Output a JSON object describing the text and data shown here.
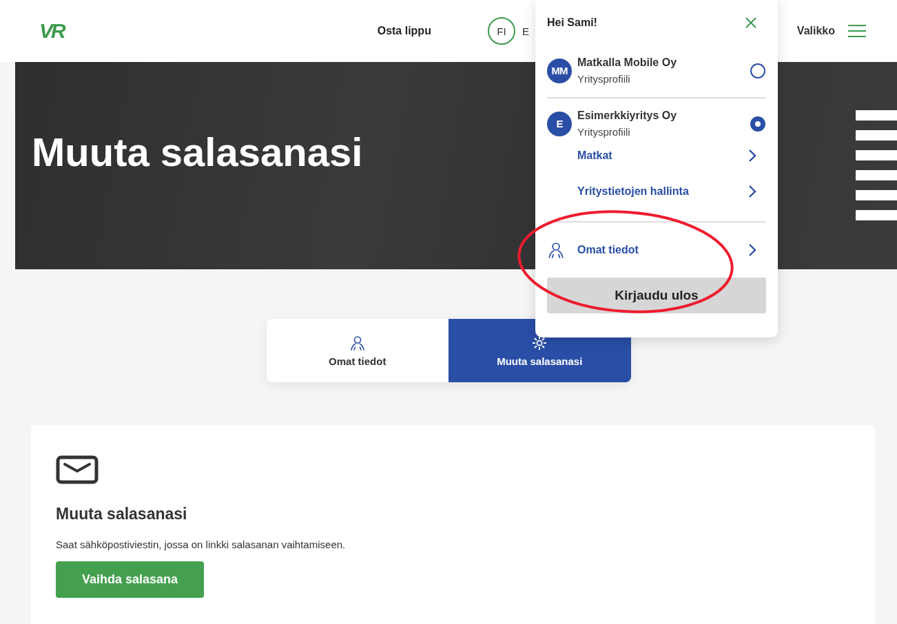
{
  "header": {
    "logo": "VR",
    "nav": [
      {
        "label": "Osta lippu"
      }
    ],
    "language": "FI",
    "language_next": "E",
    "menu": "Valikko"
  },
  "hero": {
    "title": "Muuta salasanasi"
  },
  "tabs": [
    {
      "label": "Omat tiedot",
      "kind": "person",
      "selected": false
    },
    {
      "label": "Muuta salasanasi",
      "kind": "gear",
      "selected": true
    }
  ],
  "card": {
    "heading": "Muuta salasanasi",
    "text": "Saat sähköpostiviestin, jossa on linkki salasanan vaihtamiseen.",
    "button": "Vaihda salasana"
  },
  "account_menu": {
    "greeting": "Hei Sami!",
    "profiles": [
      {
        "initials": "MM",
        "name": "Matkalla Mobile Oy",
        "type": "Yritysprofiili",
        "selected": false
      },
      {
        "initials": "E",
        "name": "Esimerkkiyritys Oy",
        "type": "Yritysprofiili",
        "selected": true,
        "links": [
          "Matkat",
          "Yritystietojen hallinta"
        ]
      }
    ],
    "own_link": "Omat tiedot",
    "logout": "Kirjaudu ulos"
  },
  "annotation": {
    "kind": "ellipse",
    "color": "#ee1c2e"
  }
}
